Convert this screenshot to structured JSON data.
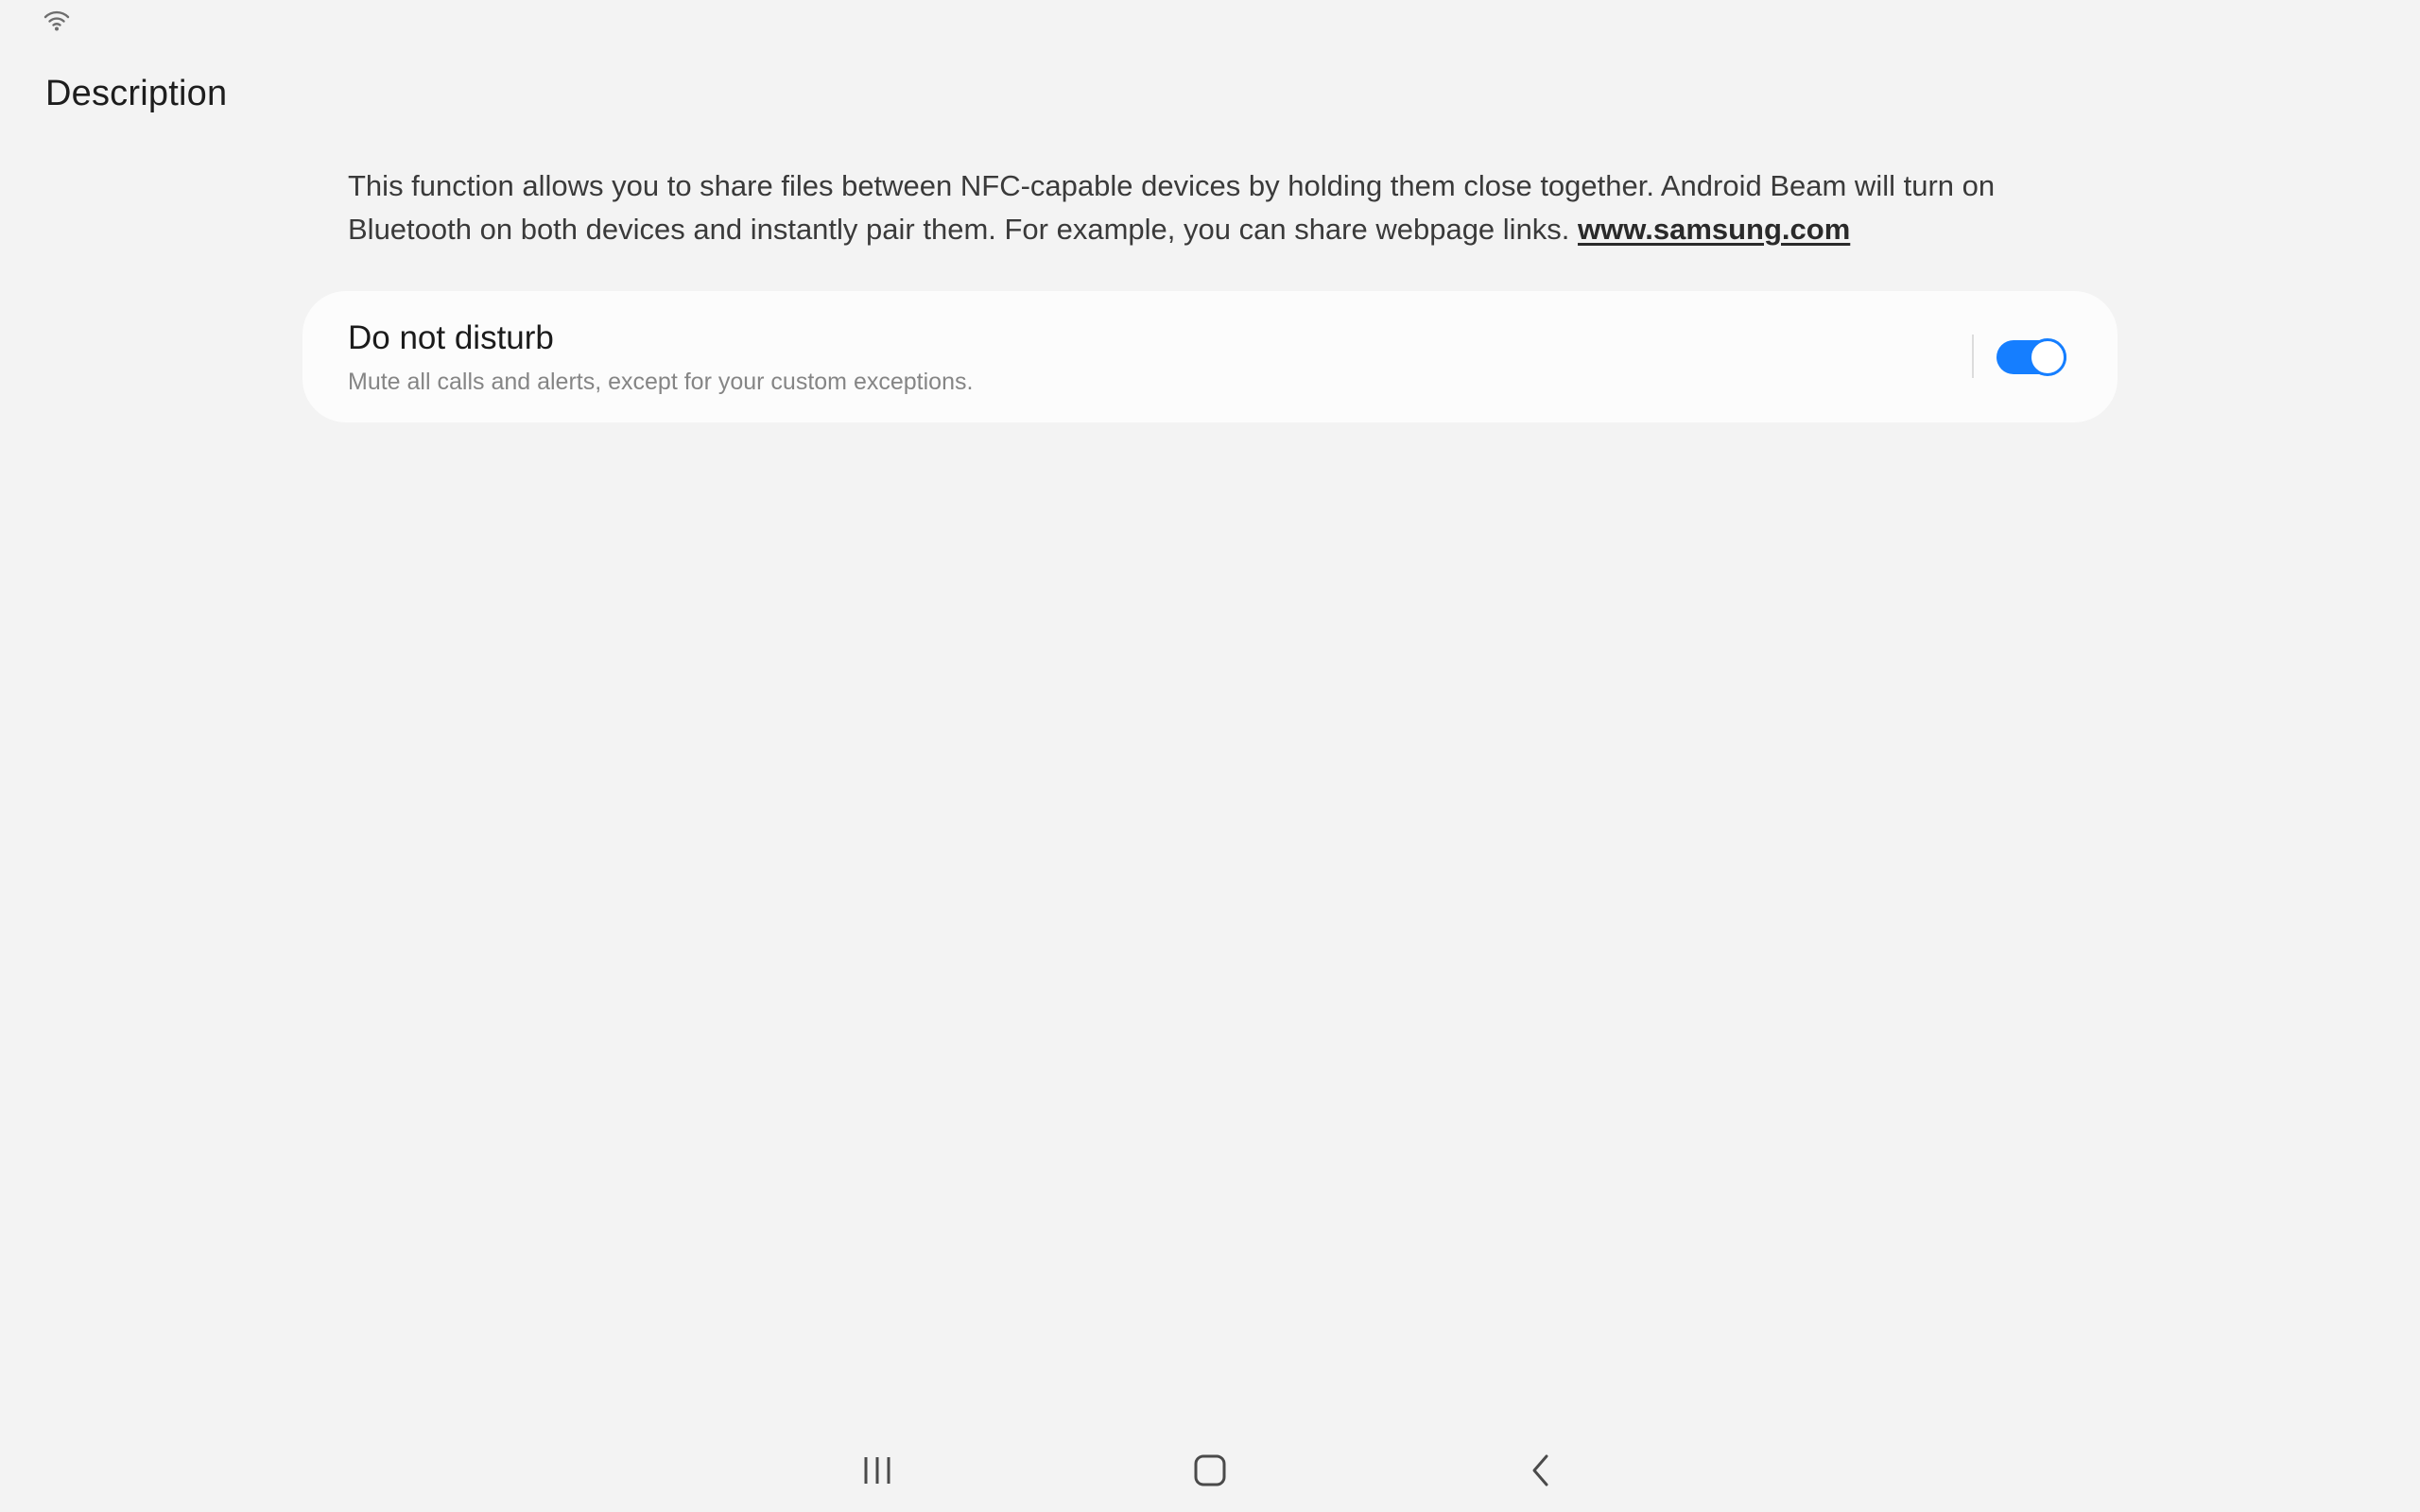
{
  "status_bar": {
    "wifi_icon": "wifi-icon"
  },
  "page": {
    "title": "Description"
  },
  "description": {
    "text": "This function allows you to share files between NFC-capable devices by holding them close together. Android Beam will  turn on Bluetooth on both devices and instantly pair them. For example, you can share webpage links. ",
    "link_text": "www.samsung.com"
  },
  "setting": {
    "title": "Do not disturb",
    "subtitle": "Mute all calls and alerts, except for your custom exceptions.",
    "enabled": true,
    "accent_color": "#157eff"
  },
  "nav_bar": {
    "recents_icon": "recents-icon",
    "home_icon": "home-icon",
    "back_icon": "back-icon"
  }
}
